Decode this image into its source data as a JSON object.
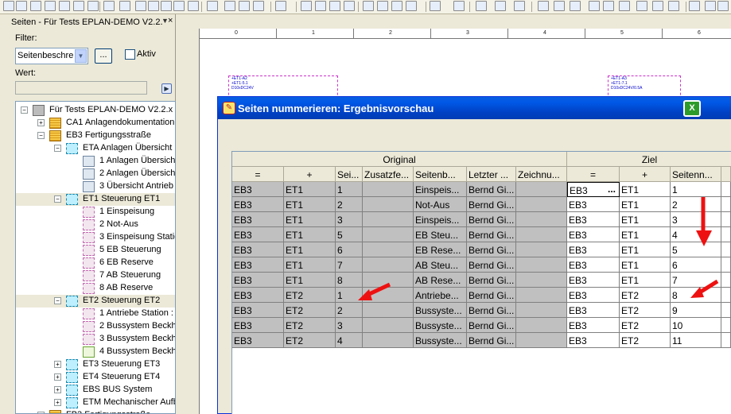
{
  "panel": {
    "title": "Seiten - Für Tests EPLAN-DEMO V2.2.",
    "filter_label": "Filter:",
    "filter_value": "Seitenbeschre",
    "filter_button": "...",
    "aktiv_label": "Aktiv",
    "wert_label": "Wert:"
  },
  "tree": [
    {
      "label": "Für Tests EPLAN-DEMO V2.2.x (",
      "icon": "root"
    },
    {
      "label": "CA1 Anlagendokumentation",
      "icon": "folder"
    },
    {
      "label": "EB3 Fertigungsstraße",
      "icon": "folder"
    },
    {
      "label": "ETA Anlagen Übersicht",
      "icon": "structure"
    },
    {
      "label": "1 Anlagen Übersich",
      "icon": "page"
    },
    {
      "label": "2 Anlagen Übersich",
      "icon": "page"
    },
    {
      "label": "3 Übersicht Antrieb",
      "icon": "page"
    },
    {
      "label": "ET1 Steuerung ET1",
      "icon": "structure"
    },
    {
      "label": "1 Einspeisung",
      "icon": "schematic"
    },
    {
      "label": "2 Not-Aus",
      "icon": "schematic"
    },
    {
      "label": "3 Einspeisung Statio",
      "icon": "schematic"
    },
    {
      "label": "5 EB Steuerung",
      "icon": "schematic"
    },
    {
      "label": "6 EB Reserve",
      "icon": "schematic"
    },
    {
      "label": "7 AB Steuerung",
      "icon": "schematic"
    },
    {
      "label": "8 AB Reserve",
      "icon": "schematic"
    },
    {
      "label": "ET2 Steuerung ET2",
      "icon": "structure"
    },
    {
      "label": "1 Antriebe Station :",
      "icon": "schematic"
    },
    {
      "label": "2 Bussystem Beckho",
      "icon": "schematic"
    },
    {
      "label": "3 Bussystem Beckho",
      "icon": "schematic"
    },
    {
      "label": "4 Bussystem Beckho",
      "icon": "bus-page"
    },
    {
      "label": "ET3 Steuerung ET3",
      "icon": "structure"
    },
    {
      "label": "ET4 Steuerung ET4",
      "icon": "structure"
    },
    {
      "label": "EBS BUS System",
      "icon": "structure"
    },
    {
      "label": "ETM Mechanischer Aufb",
      "icon": "structure"
    },
    {
      "label": "FB3 Fertigungsstraße",
      "icon": "folder"
    }
  ],
  "ruler": [
    "0",
    "1",
    "2",
    "3",
    "4",
    "5",
    "6"
  ],
  "drawing": {
    "part1": [
      "+ET1-A2",
      "+ET1-5.1",
      "D10xDC24V",
      "B..."
    ],
    "part2": [
      "+ET1-A3",
      "+ET1-7.1",
      "D10xDC24V/0.5A",
      "B..."
    ]
  },
  "dialog": {
    "title": "Seiten nummerieren: Ergebnisvorschau",
    "group_original": "Original",
    "group_ziel": "Ziel",
    "columns_original": [
      "=",
      "+",
      "Sei...",
      "Zusatzfe...",
      "Seitenb...",
      "Letzter ...",
      "Zeichnu..."
    ],
    "columns_ziel": [
      "=",
      "+",
      "Seitenn..."
    ],
    "rows": [
      {
        "o": [
          "EB3",
          "ET1",
          "1",
          "",
          "Einspeis...",
          "Bernd Gi...",
          ""
        ],
        "z": [
          "EB3",
          "ET1",
          "1"
        ]
      },
      {
        "o": [
          "EB3",
          "ET1",
          "2",
          "",
          "Not-Aus",
          "Bernd Gi...",
          ""
        ],
        "z": [
          "EB3",
          "ET1",
          "2"
        ]
      },
      {
        "o": [
          "EB3",
          "ET1",
          "3",
          "",
          "Einspeis...",
          "Bernd Gi...",
          ""
        ],
        "z": [
          "EB3",
          "ET1",
          "3"
        ]
      },
      {
        "o": [
          "EB3",
          "ET1",
          "5",
          "",
          "EB Steu...",
          "Bernd Gi...",
          ""
        ],
        "z": [
          "EB3",
          "ET1",
          "4"
        ]
      },
      {
        "o": [
          "EB3",
          "ET1",
          "6",
          "",
          "EB Rese...",
          "Bernd Gi...",
          ""
        ],
        "z": [
          "EB3",
          "ET1",
          "5"
        ]
      },
      {
        "o": [
          "EB3",
          "ET1",
          "7",
          "",
          "AB Steu...",
          "Bernd Gi...",
          ""
        ],
        "z": [
          "EB3",
          "ET1",
          "6"
        ]
      },
      {
        "o": [
          "EB3",
          "ET1",
          "8",
          "",
          "AB Rese...",
          "Bernd Gi...",
          ""
        ],
        "z": [
          "EB3",
          "ET1",
          "7"
        ]
      },
      {
        "o": [
          "EB3",
          "ET2",
          "1",
          "",
          "Antriebe...",
          "Bernd Gi...",
          ""
        ],
        "z": [
          "EB3",
          "ET2",
          "8"
        ]
      },
      {
        "o": [
          "EB3",
          "ET2",
          "2",
          "",
          "Bussyste...",
          "Bernd Gi...",
          ""
        ],
        "z": [
          "EB3",
          "ET2",
          "9"
        ]
      },
      {
        "o": [
          "EB3",
          "ET2",
          "3",
          "",
          "Bussyste...",
          "Bernd Gi...",
          ""
        ],
        "z": [
          "EB3",
          "ET2",
          "10"
        ]
      },
      {
        "o": [
          "EB3",
          "ET2",
          "4",
          "",
          "Bussyste...",
          "Bernd Gi...",
          ""
        ],
        "z": [
          "EB3",
          "ET2",
          "11"
        ]
      }
    ],
    "edit_dots": "...",
    "excel_icon": "excel-export-icon"
  },
  "colors": {
    "titlebar": "#0054e3",
    "grid_gray": "#c0c0c0",
    "arrow_red": "#ee1111"
  }
}
